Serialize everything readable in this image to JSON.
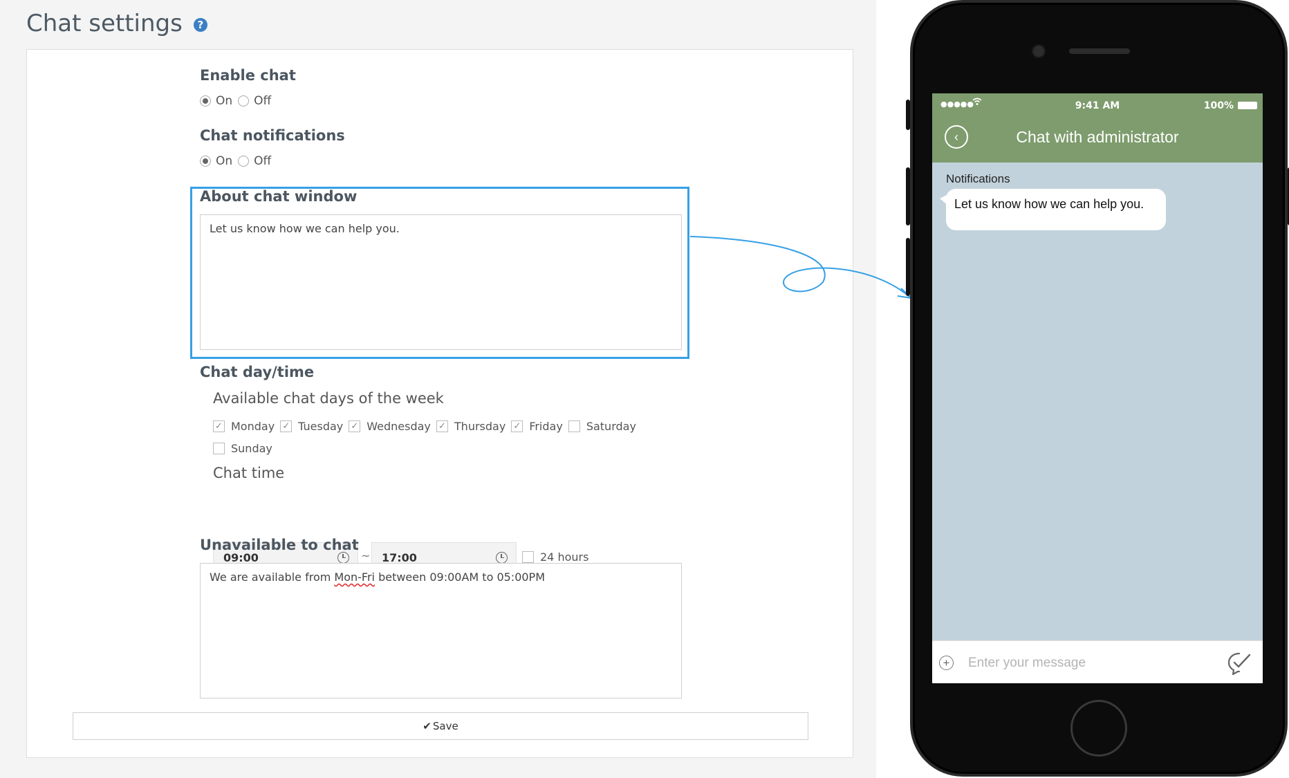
{
  "page": {
    "title": "Chat settings"
  },
  "enable_chat": {
    "label": "Enable chat",
    "on_label": "On",
    "off_label": "Off",
    "selected": "On"
  },
  "chat_notifications": {
    "label": "Chat notifications",
    "on_label": "On",
    "off_label": "Off",
    "selected": "On"
  },
  "about_chat_window": {
    "label": "About chat window",
    "value": "Let us know how we can help you."
  },
  "chat_day_time": {
    "label": "Chat day/time",
    "days_label": "Available chat days of the week",
    "days": [
      {
        "name": "Monday",
        "checked": true
      },
      {
        "name": "Tuesday",
        "checked": true
      },
      {
        "name": "Wednesday",
        "checked": true
      },
      {
        "name": "Thursday",
        "checked": true
      },
      {
        "name": "Friday",
        "checked": true
      },
      {
        "name": "Saturday",
        "checked": false
      },
      {
        "name": "Sunday",
        "checked": false
      }
    ],
    "time_label": "Chat time",
    "start_time": "09:00",
    "separator": "~",
    "end_time": "17:00",
    "all_day_label": "24 hours",
    "all_day_checked": false
  },
  "unavailable": {
    "label": "Unavailable to chat",
    "value_before": "We are available from ",
    "value_misspelled": "Mon-Fri",
    "value_after": " between 09:00AM to 05:00PM"
  },
  "save": {
    "label": "Save"
  },
  "phone": {
    "status": {
      "signal": "●●●●●",
      "time": "9:41 AM",
      "battery": "100%"
    },
    "chat_title": "Chat with administrator",
    "notifications_label": "Notifications",
    "message": "Let us know how we can help you.",
    "input_placeholder": "Enter your message"
  },
  "colors": {
    "highlight": "#35a0e6",
    "phone_header": "#7e9c6d",
    "chat_background": "#c2d2dc",
    "help_icon": "#3b7fc4"
  },
  "icons": {
    "help": "question-circle-icon",
    "clock": "clock-icon",
    "save": "check-icon",
    "back": "chevron-left-icon",
    "add": "plus-circle-icon",
    "send": "send-check-icon",
    "wifi": "wifi-icon",
    "battery": "battery-icon"
  }
}
